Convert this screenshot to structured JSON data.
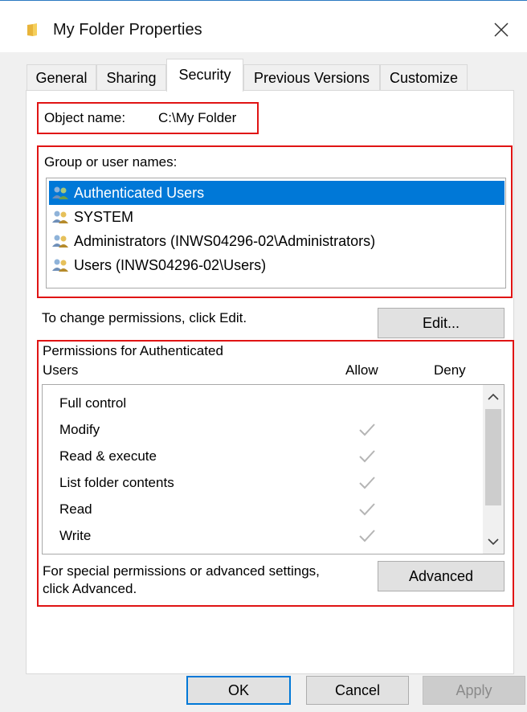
{
  "window": {
    "title": "My Folder Properties",
    "close_icon": "close-icon",
    "title_icon": "folder-icon",
    "accent": "#0078d7"
  },
  "tabs": [
    {
      "label": "General"
    },
    {
      "label": "Sharing"
    },
    {
      "label": "Security"
    },
    {
      "label": "Previous Versions"
    },
    {
      "label": "Customize"
    }
  ],
  "security": {
    "object_label": "Object name:",
    "object_value": "C:\\My Folder",
    "group_label": "Group or user names:",
    "users": [
      {
        "name": "Authenticated Users",
        "selected": true
      },
      {
        "name": "SYSTEM"
      },
      {
        "name": "Administrators (INWS04296-02\\Administrators)"
      },
      {
        "name": "Users (INWS04296-02\\Users)"
      }
    ],
    "change_text": "To change permissions, click Edit.",
    "edit_button": "Edit...",
    "perm_header_line1": "Permissions for Authenticated",
    "perm_header_line2": "Users",
    "allow_label": "Allow",
    "deny_label": "Deny",
    "permissions": [
      {
        "name": "Full control",
        "allow": false
      },
      {
        "name": "Modify",
        "allow": true
      },
      {
        "name": "Read & execute",
        "allow": true
      },
      {
        "name": "List folder contents",
        "allow": true
      },
      {
        "name": "Read",
        "allow": true
      },
      {
        "name": "Write",
        "allow": true
      }
    ],
    "advanced_text_line1": "For special permissions or advanced settings,",
    "advanced_text_line2": "click Advanced.",
    "advanced_button": "Advanced"
  },
  "footer": {
    "ok": "OK",
    "cancel": "Cancel",
    "apply": "Apply"
  }
}
